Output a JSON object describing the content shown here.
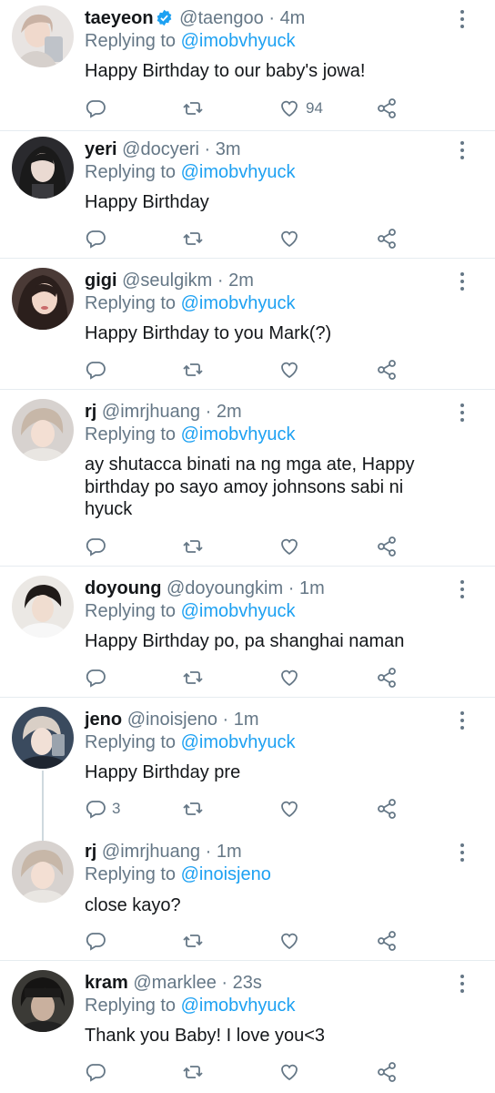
{
  "tweets": [
    {
      "name": "taeyeon",
      "verified": true,
      "handle": "@taengoo",
      "time": "4m",
      "replying_prefix": "Replying to",
      "replying_to": "@imobvhyuck",
      "text": "Happy Birthday to our baby's jowa!",
      "reply_count": "",
      "like_count": "94"
    },
    {
      "name": "yeri",
      "verified": false,
      "handle": "@docyeri",
      "time": "3m",
      "replying_prefix": "Replying to",
      "replying_to": "@imobvhyuck",
      "text": "Happy Birthday",
      "reply_count": "",
      "like_count": ""
    },
    {
      "name": "gigi",
      "verified": false,
      "handle": "@seulgikm",
      "time": "2m",
      "replying_prefix": "Replying to",
      "replying_to": "@imobvhyuck",
      "text": "Happy Birthday to you Mark(?)",
      "reply_count": "",
      "like_count": ""
    },
    {
      "name": "rj",
      "verified": false,
      "handle": "@imrjhuang",
      "time": "2m",
      "replying_prefix": "Replying to",
      "replying_to": "@imobvhyuck",
      "text": "ay shutacca binati na ng mga ate, Happy birthday po sayo amoy johnsons sabi ni hyuck",
      "reply_count": "",
      "like_count": ""
    },
    {
      "name": "doyoung",
      "verified": false,
      "handle": "@doyoungkim",
      "time": "1m",
      "replying_prefix": "Replying to",
      "replying_to": "@imobvhyuck",
      "text": "Happy Birthday po, pa shanghai naman",
      "reply_count": "",
      "like_count": ""
    },
    {
      "name": "jeno",
      "verified": false,
      "handle": "@inoisjeno",
      "time": "1m",
      "replying_prefix": "Replying to",
      "replying_to": "@imobvhyuck",
      "text": "Happy Birthday pre",
      "reply_count": "3",
      "like_count": ""
    },
    {
      "name": "rj",
      "verified": false,
      "handle": "@imrjhuang",
      "time": "1m",
      "replying_prefix": "Replying to",
      "replying_to": "@inoisjeno",
      "text": "close kayo?",
      "reply_count": "",
      "like_count": ""
    },
    {
      "name": "kram",
      "verified": false,
      "handle": "@marklee",
      "time": "23s",
      "replying_prefix": "Replying to",
      "replying_to": "@imobvhyuck",
      "text": "Thank you Baby! I love you<3",
      "reply_count": "",
      "like_count": ""
    }
  ],
  "separator": "·",
  "icons": {
    "reply": "reply-icon",
    "retweet": "retweet-icon",
    "like": "heart-icon",
    "share": "share-icon",
    "more": "more-vertical-icon",
    "verified": "verified-badge-icon"
  },
  "colors": {
    "link": "#1da1f2",
    "secondary": "#657786",
    "text": "#14171a",
    "divider": "#e6ecf0"
  }
}
